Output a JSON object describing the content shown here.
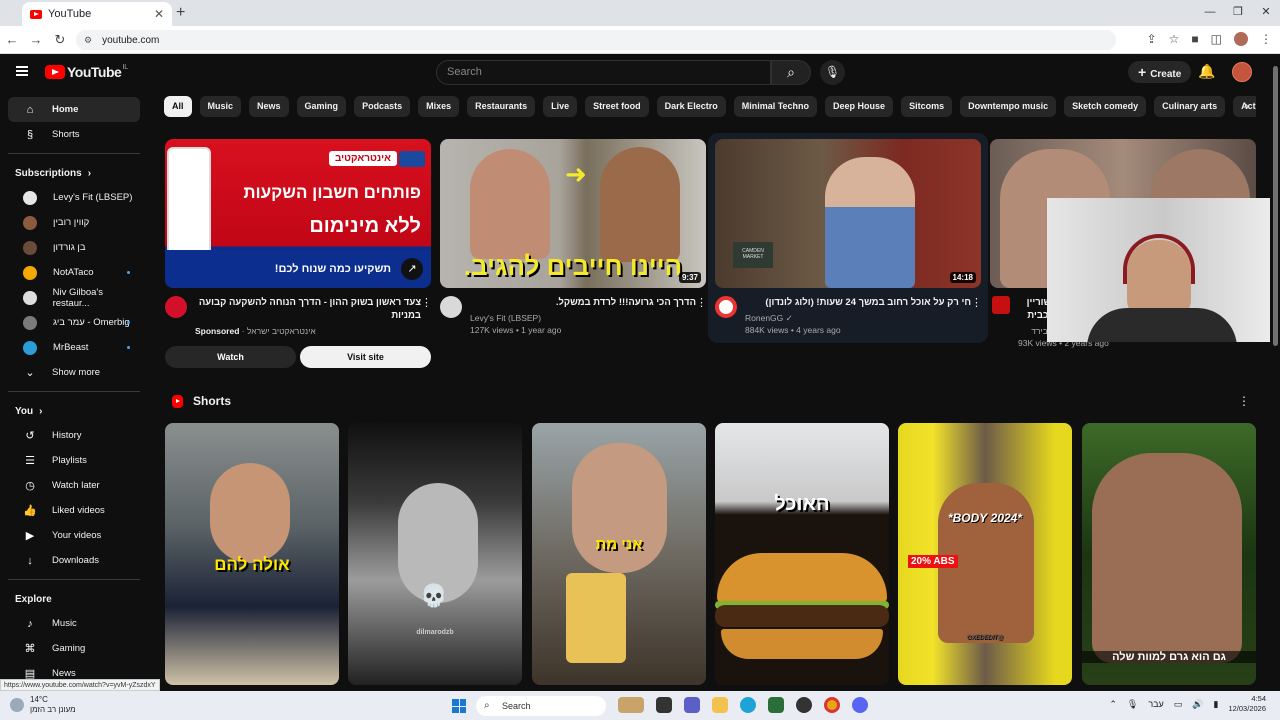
{
  "browser": {
    "tab_title": "YouTube",
    "url": "youtube.com",
    "status_url": "https://www.youtube.com/watch?v=yvM-yZszdxY"
  },
  "header": {
    "logo_text": "YouTube",
    "country": "IL",
    "search_placeholder": "Search",
    "create_label": "Create"
  },
  "sidebar": {
    "top": [
      {
        "label": "Home",
        "icon": "home-icon"
      },
      {
        "label": "Shorts",
        "icon": "shorts-icon"
      }
    ],
    "subscriptions_title": "Subscriptions",
    "subscriptions": [
      {
        "label": "Levy's Fit (LBSEP)",
        "color": "#e6e6e6",
        "dot": false
      },
      {
        "label": "קווין רובין",
        "color": "#8c5a3c",
        "dot": false
      },
      {
        "label": "בן גורדון",
        "color": "#6b4b3a",
        "dot": false
      },
      {
        "label": "NotATaco",
        "color": "#f2a900",
        "dot": true
      },
      {
        "label": "Niv Gilboa's restaur...",
        "color": "#ddd",
        "dot": false
      },
      {
        "label": "עמר ביג - Omerbig",
        "color": "#7a7a7a",
        "dot": true
      },
      {
        "label": "MrBeast",
        "color": "#2b9cd8",
        "dot": true
      }
    ],
    "show_more": "Show more",
    "you_title": "You",
    "you_items": [
      {
        "label": "History",
        "icon": "history-icon"
      },
      {
        "label": "Playlists",
        "icon": "playlists-icon"
      },
      {
        "label": "Watch later",
        "icon": "watch-later-icon"
      },
      {
        "label": "Liked videos",
        "icon": "thumbs-up-icon"
      },
      {
        "label": "Your videos",
        "icon": "your-videos-icon"
      },
      {
        "label": "Downloads",
        "icon": "download-icon"
      }
    ],
    "explore_title": "Explore",
    "explore_items": [
      {
        "label": "Music",
        "icon": "music-icon"
      },
      {
        "label": "Gaming",
        "icon": "gaming-icon"
      },
      {
        "label": "News",
        "icon": "news-icon"
      }
    ]
  },
  "chips": [
    "All",
    "Music",
    "News",
    "Gaming",
    "Podcasts",
    "Mixes",
    "Restaurants",
    "Live",
    "Street food",
    "Dark Electro",
    "Minimal Techno",
    "Deep House",
    "Sitcoms",
    "Downtempo music",
    "Sketch comedy",
    "Culinary arts",
    "Action-adventure games"
  ],
  "videos": [
    {
      "title": "צעד ראשון בשוק ההון - הדרך הנוחה להשקעה קבועה במניות",
      "sponsored": "Sponsored",
      "channel": "אינטראקטיב ישראל",
      "tag": "אינטראקטיב",
      "thumb_line1": "פותחים חשבון השקעות",
      "thumb_line2": "ללא מינימום",
      "thumb_strip": "תשקיעו כמה שנוח לכם!",
      "btn_watch": "Watch",
      "btn_visit": "Visit site"
    },
    {
      "title": "הדרך הכי גרועה!!! לרדת במשקל.",
      "channel": "Levy's Fit (LBSEP)",
      "stats": "127K views • 1 year ago",
      "duration": "9:37",
      "thumb_caption": "היינו חייבים להגיב."
    },
    {
      "title": "חי רק על אוכל רחוב במשך 24 שעות! (ולוג לונדון)",
      "channel": "RonenGG",
      "verified": "✓",
      "stats": "884K views • 4 years ago",
      "duration": "14:18",
      "sign_text": "CAMDEN MARKET"
    },
    {
      "title": "משוריין מוכבית",
      "channel": "אקבירד",
      "stats": "93K views • 2 years ago"
    }
  ],
  "shorts": {
    "title": "Shorts",
    "items": [
      {
        "caption": "אולה להם"
      },
      {
        "caption": "dilmarodzb"
      },
      {
        "caption": "אני מת"
      },
      {
        "caption": "האוכל"
      },
      {
        "caption": "*2024 BODY*",
        "badge": "20% ABS",
        "watermark": "@OXEDEDIT"
      },
      {
        "caption": "גם הוא גרם למוות שלה"
      }
    ]
  },
  "taskbar": {
    "temp": "14°C",
    "weather": "מעונן רב הזמן",
    "search": "Search",
    "lang": "עבר",
    "time": "4:54",
    "date": "12/03/2026"
  }
}
